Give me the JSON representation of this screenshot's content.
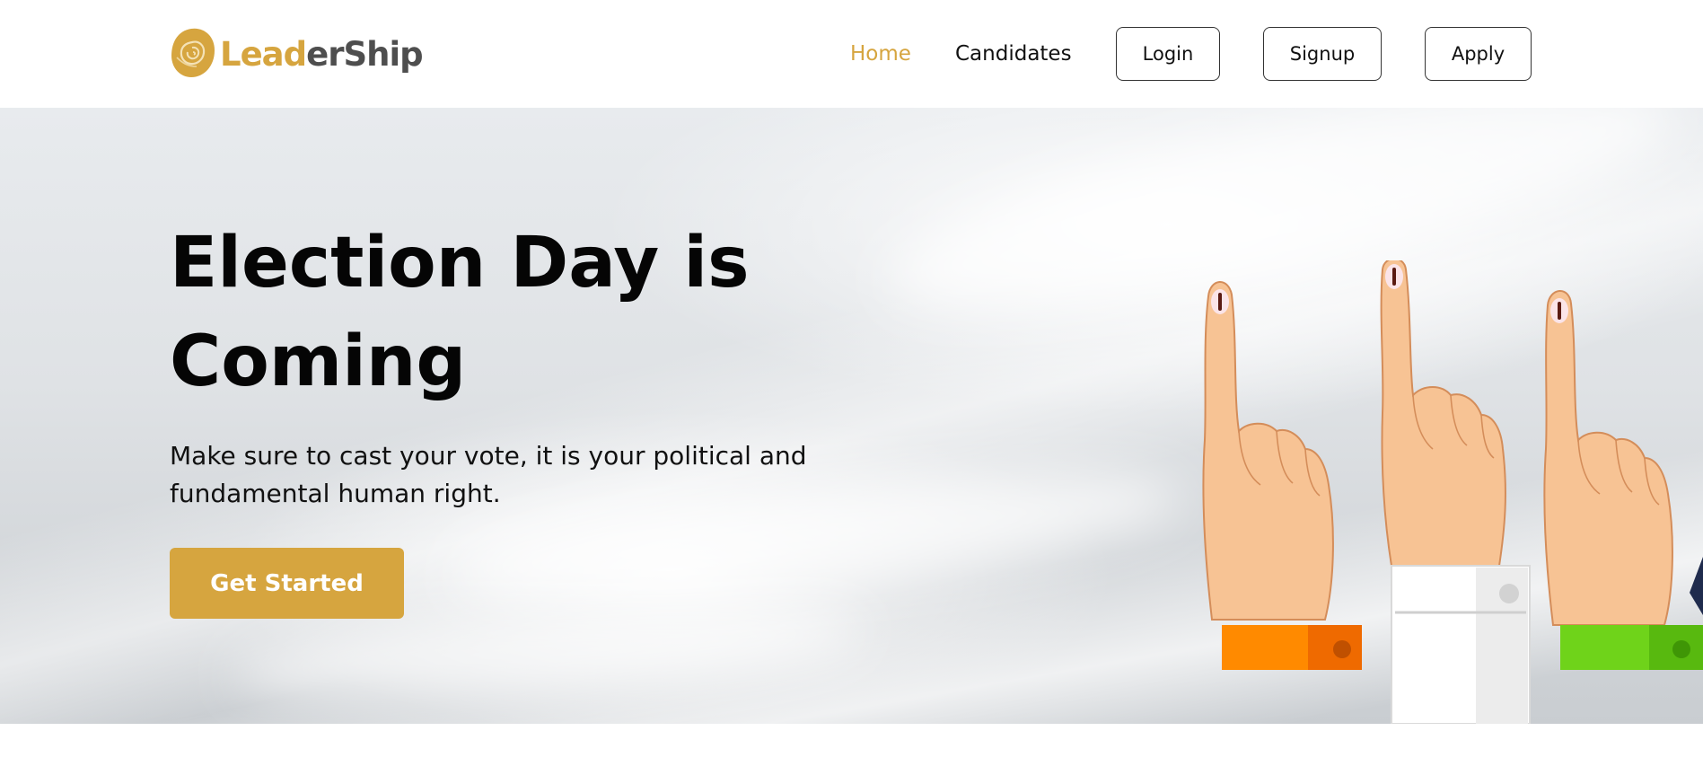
{
  "brand": {
    "name_part1": "Lead",
    "name_part2": "erShip",
    "accent_color": "#d6a53f",
    "logo_icon": "rose-logo-icon"
  },
  "nav": {
    "home": "Home",
    "candidates": "Candidates",
    "login": "Login",
    "signup": "Signup",
    "apply": "Apply",
    "active_item": "Home"
  },
  "hero": {
    "title": "Election Day is Coming",
    "subtitle": "Make sure to cast your vote, it is your political and fundamental human right.",
    "cta_label": "Get Started",
    "cta_color": "#d6a53f",
    "illustration": "voting-hands-illustration"
  }
}
